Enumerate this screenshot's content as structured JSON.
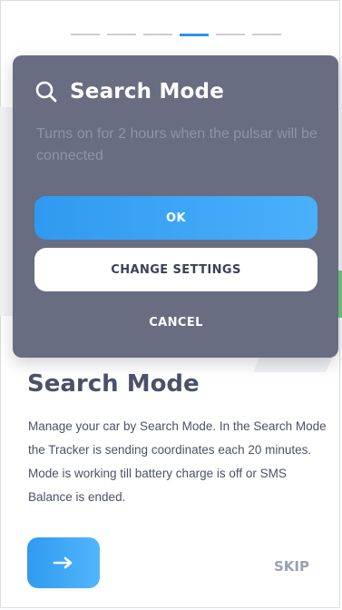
{
  "onboarding": {
    "heading": "Search Mode",
    "body": "Manage your car by Search Mode. In the Search Mode the Tracker is sending coordinates each 20 minutes. Mode is working till battery charge is off or SMS Balance is ended.",
    "skip_label": "SKIP",
    "next_icon": "arrow-right-icon",
    "pager": {
      "total": 6,
      "active": 4
    }
  },
  "dialog": {
    "title": "Search Mode",
    "title_icon": "search-icon",
    "description": "Turns on for 2 hours when the pulsar will be connected",
    "ok_label": "OK",
    "change_label": "CHANGE SETTINGS",
    "cancel_label": "CANCEL"
  },
  "colors": {
    "accent": "#2b95f1",
    "dialog_bg": "#686d82",
    "heading_text": "#4a5168"
  }
}
